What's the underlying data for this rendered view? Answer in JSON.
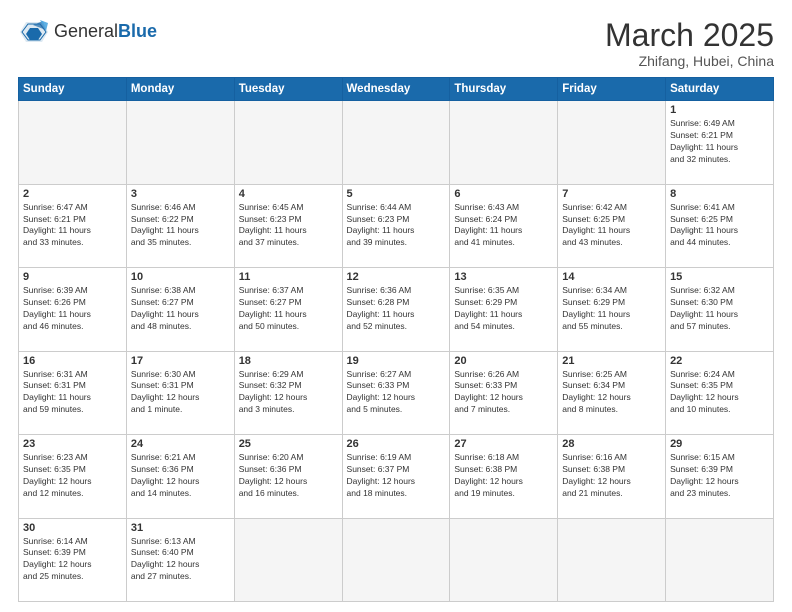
{
  "header": {
    "logo_general": "General",
    "logo_blue": "Blue",
    "month": "March 2025",
    "location": "Zhifang, Hubei, China"
  },
  "days_of_week": [
    "Sunday",
    "Monday",
    "Tuesday",
    "Wednesday",
    "Thursday",
    "Friday",
    "Saturday"
  ],
  "weeks": [
    [
      {
        "day": "",
        "info": ""
      },
      {
        "day": "",
        "info": ""
      },
      {
        "day": "",
        "info": ""
      },
      {
        "day": "",
        "info": ""
      },
      {
        "day": "",
        "info": ""
      },
      {
        "day": "",
        "info": ""
      },
      {
        "day": "1",
        "info": "Sunrise: 6:49 AM\nSunset: 6:21 PM\nDaylight: 11 hours\nand 32 minutes."
      }
    ],
    [
      {
        "day": "2",
        "info": "Sunrise: 6:47 AM\nSunset: 6:21 PM\nDaylight: 11 hours\nand 33 minutes."
      },
      {
        "day": "3",
        "info": "Sunrise: 6:46 AM\nSunset: 6:22 PM\nDaylight: 11 hours\nand 35 minutes."
      },
      {
        "day": "4",
        "info": "Sunrise: 6:45 AM\nSunset: 6:23 PM\nDaylight: 11 hours\nand 37 minutes."
      },
      {
        "day": "5",
        "info": "Sunrise: 6:44 AM\nSunset: 6:23 PM\nDaylight: 11 hours\nand 39 minutes."
      },
      {
        "day": "6",
        "info": "Sunrise: 6:43 AM\nSunset: 6:24 PM\nDaylight: 11 hours\nand 41 minutes."
      },
      {
        "day": "7",
        "info": "Sunrise: 6:42 AM\nSunset: 6:25 PM\nDaylight: 11 hours\nand 43 minutes."
      },
      {
        "day": "8",
        "info": "Sunrise: 6:41 AM\nSunset: 6:25 PM\nDaylight: 11 hours\nand 44 minutes."
      }
    ],
    [
      {
        "day": "9",
        "info": "Sunrise: 6:39 AM\nSunset: 6:26 PM\nDaylight: 11 hours\nand 46 minutes."
      },
      {
        "day": "10",
        "info": "Sunrise: 6:38 AM\nSunset: 6:27 PM\nDaylight: 11 hours\nand 48 minutes."
      },
      {
        "day": "11",
        "info": "Sunrise: 6:37 AM\nSunset: 6:27 PM\nDaylight: 11 hours\nand 50 minutes."
      },
      {
        "day": "12",
        "info": "Sunrise: 6:36 AM\nSunset: 6:28 PM\nDaylight: 11 hours\nand 52 minutes."
      },
      {
        "day": "13",
        "info": "Sunrise: 6:35 AM\nSunset: 6:29 PM\nDaylight: 11 hours\nand 54 minutes."
      },
      {
        "day": "14",
        "info": "Sunrise: 6:34 AM\nSunset: 6:29 PM\nDaylight: 11 hours\nand 55 minutes."
      },
      {
        "day": "15",
        "info": "Sunrise: 6:32 AM\nSunset: 6:30 PM\nDaylight: 11 hours\nand 57 minutes."
      }
    ],
    [
      {
        "day": "16",
        "info": "Sunrise: 6:31 AM\nSunset: 6:31 PM\nDaylight: 11 hours\nand 59 minutes."
      },
      {
        "day": "17",
        "info": "Sunrise: 6:30 AM\nSunset: 6:31 PM\nDaylight: 12 hours\nand 1 minute."
      },
      {
        "day": "18",
        "info": "Sunrise: 6:29 AM\nSunset: 6:32 PM\nDaylight: 12 hours\nand 3 minutes."
      },
      {
        "day": "19",
        "info": "Sunrise: 6:27 AM\nSunset: 6:33 PM\nDaylight: 12 hours\nand 5 minutes."
      },
      {
        "day": "20",
        "info": "Sunrise: 6:26 AM\nSunset: 6:33 PM\nDaylight: 12 hours\nand 7 minutes."
      },
      {
        "day": "21",
        "info": "Sunrise: 6:25 AM\nSunset: 6:34 PM\nDaylight: 12 hours\nand 8 minutes."
      },
      {
        "day": "22",
        "info": "Sunrise: 6:24 AM\nSunset: 6:35 PM\nDaylight: 12 hours\nand 10 minutes."
      }
    ],
    [
      {
        "day": "23",
        "info": "Sunrise: 6:23 AM\nSunset: 6:35 PM\nDaylight: 12 hours\nand 12 minutes."
      },
      {
        "day": "24",
        "info": "Sunrise: 6:21 AM\nSunset: 6:36 PM\nDaylight: 12 hours\nand 14 minutes."
      },
      {
        "day": "25",
        "info": "Sunrise: 6:20 AM\nSunset: 6:36 PM\nDaylight: 12 hours\nand 16 minutes."
      },
      {
        "day": "26",
        "info": "Sunrise: 6:19 AM\nSunset: 6:37 PM\nDaylight: 12 hours\nand 18 minutes."
      },
      {
        "day": "27",
        "info": "Sunrise: 6:18 AM\nSunset: 6:38 PM\nDaylight: 12 hours\nand 19 minutes."
      },
      {
        "day": "28",
        "info": "Sunrise: 6:16 AM\nSunset: 6:38 PM\nDaylight: 12 hours\nand 21 minutes."
      },
      {
        "day": "29",
        "info": "Sunrise: 6:15 AM\nSunset: 6:39 PM\nDaylight: 12 hours\nand 23 minutes."
      }
    ],
    [
      {
        "day": "30",
        "info": "Sunrise: 6:14 AM\nSunset: 6:39 PM\nDaylight: 12 hours\nand 25 minutes."
      },
      {
        "day": "31",
        "info": "Sunrise: 6:13 AM\nSunset: 6:40 PM\nDaylight: 12 hours\nand 27 minutes."
      },
      {
        "day": "",
        "info": ""
      },
      {
        "day": "",
        "info": ""
      },
      {
        "day": "",
        "info": ""
      },
      {
        "day": "",
        "info": ""
      },
      {
        "day": "",
        "info": ""
      }
    ]
  ]
}
